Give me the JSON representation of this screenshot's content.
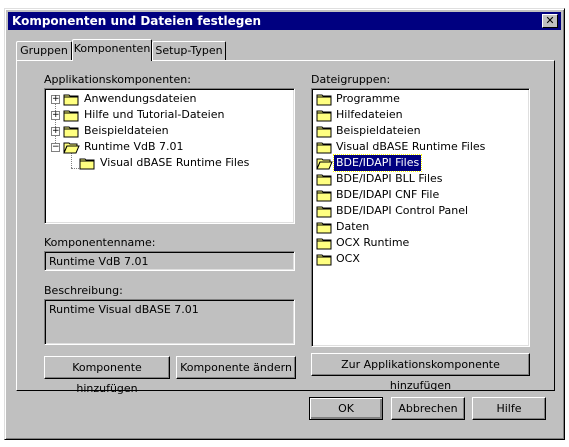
{
  "window": {
    "title": "Komponenten und Dateien festlegen",
    "close_glyph": "✕"
  },
  "tabs": [
    {
      "label": "Gruppen",
      "active": false
    },
    {
      "label": "Komponenten",
      "active": true
    },
    {
      "label": "Setup-Typen",
      "active": false
    }
  ],
  "left": {
    "heading": "Applikationskomponenten:",
    "tree": [
      {
        "label": "Anwendungsdateien",
        "expander": "+",
        "selected": false
      },
      {
        "label": "Hilfe und Tutorial-Dateien",
        "expander": "+",
        "selected": false
      },
      {
        "label": "Beispieldateien",
        "expander": "+",
        "selected": false
      },
      {
        "label": "Runtime VdB 7.01",
        "expander": "−",
        "selected": false,
        "open": true
      },
      {
        "label": "Visual dBASE Runtime Files",
        "expander": "",
        "selected": false,
        "child": true
      }
    ],
    "name_label": "Komponentenname:",
    "name_value": "Runtime VdB 7.01",
    "desc_label": "Beschreibung:",
    "desc_value": "Runtime Visual dBASE 7.01",
    "add_button": "Komponente hinzufügen",
    "change_button": "Komponente ändern"
  },
  "right": {
    "heading": "Dateigruppen:",
    "items": [
      {
        "label": "Programme",
        "selected": false
      },
      {
        "label": "Hilfedateien",
        "selected": false
      },
      {
        "label": "Beispieldateien",
        "selected": false
      },
      {
        "label": "Visual dBASE Runtime Files",
        "selected": false
      },
      {
        "label": "BDE/IDAPI Files",
        "selected": true
      },
      {
        "label": "BDE/IDAPI BLL Files",
        "selected": false
      },
      {
        "label": "BDE/IDAPI CNF File",
        "selected": false
      },
      {
        "label": "BDE/IDAPI Control Panel",
        "selected": false
      },
      {
        "label": "Daten",
        "selected": false
      },
      {
        "label": "OCX Runtime",
        "selected": false
      },
      {
        "label": "OCX",
        "selected": false
      }
    ],
    "add_button": "Zur Applikationskomponente hinzufügen"
  },
  "footer": {
    "ok": "OK",
    "cancel": "Abbrechen",
    "help": "Hilfe"
  },
  "colors": {
    "face": "#c0c0c0",
    "titlebar": "#000080",
    "folder": "#ffff80",
    "selection": "#000080"
  }
}
